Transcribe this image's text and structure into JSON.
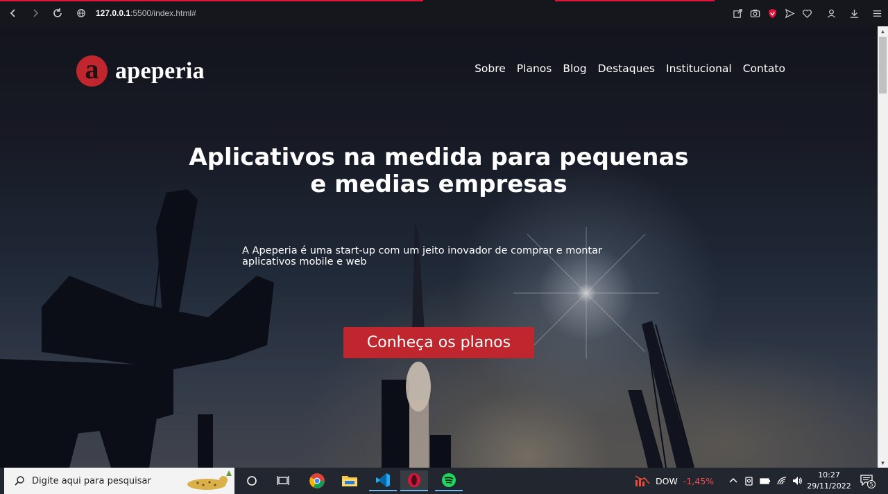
{
  "browser": {
    "url_host": "127.0.0.1",
    "url_path": ":5500/index.html#",
    "accent_color": "#e0143c"
  },
  "site": {
    "logo_letter": "a",
    "logo_text": "apeperia",
    "brand_color": "#c0262d",
    "nav": [
      "Sobre",
      "Planos",
      "Blog",
      "Destaques",
      "Institucional",
      "Contato"
    ],
    "hero_title_line1": "Aplicativos na medida para pequenas",
    "hero_title_line2": "e medias empresas",
    "hero_subtitle_line1": "A Apeperia é uma start-up com um jeito inovador de comprar e montar",
    "hero_subtitle_line2": "aplicativos mobile e web",
    "cta_label": "Conheça os planos"
  },
  "taskbar": {
    "search_placeholder": "Digite aqui para pesquisar",
    "apps": [
      "task-view",
      "chrome",
      "file-explorer",
      "vscode",
      "opera",
      "spotify"
    ],
    "stock_label": "DOW",
    "stock_change": "-1,45%",
    "time": "10:27",
    "date": "29/11/2022",
    "notification_count": "5"
  }
}
